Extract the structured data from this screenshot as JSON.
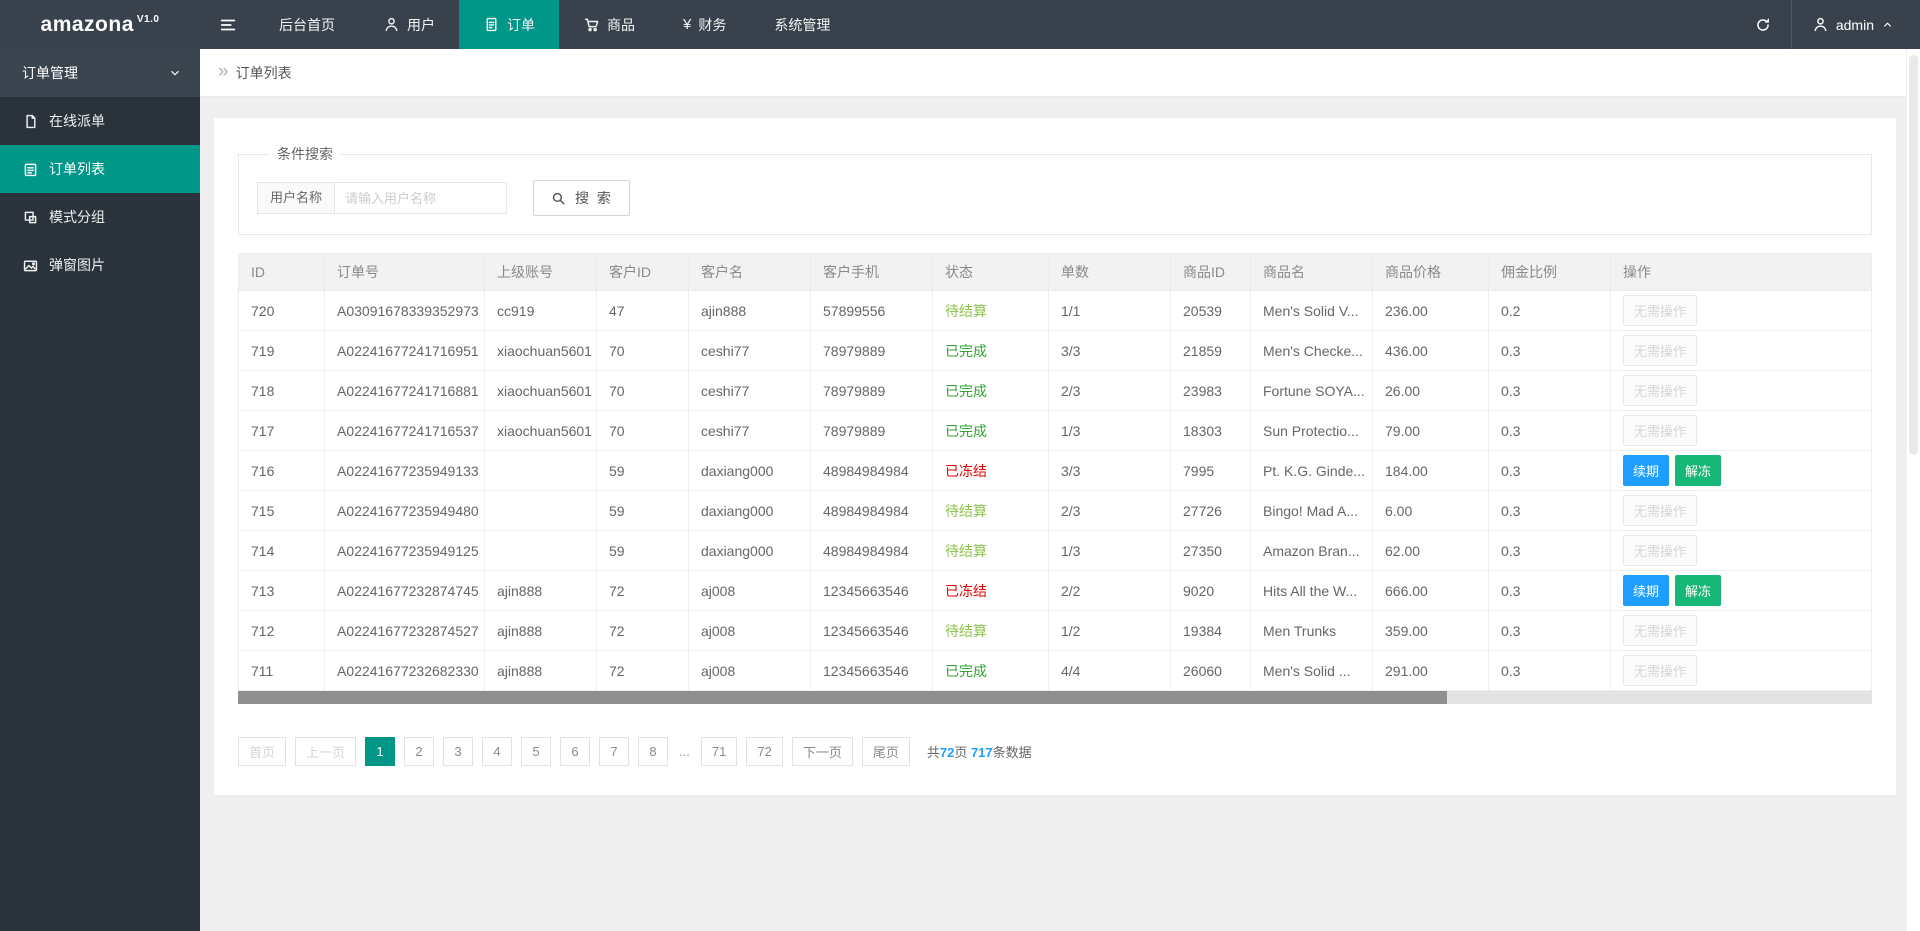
{
  "colors": {
    "navbar": "#39424c",
    "sidebar": "#2a333c",
    "accent": "#009688",
    "blue": "#1e9fff",
    "green2": "#16b777",
    "status-pending": "#8bc34a",
    "status-done": "#2da52d",
    "status-frozen": "#e60000"
  },
  "brand": {
    "name": "amazona",
    "version": "V1.0"
  },
  "navbar": {
    "items": [
      {
        "key": "home",
        "label": "后台首页",
        "icon": null,
        "active": false
      },
      {
        "key": "users",
        "label": "用户",
        "icon": "user",
        "active": false
      },
      {
        "key": "orders",
        "label": "订单",
        "icon": "file",
        "active": true
      },
      {
        "key": "goods",
        "label": "商品",
        "icon": "cart",
        "active": false
      },
      {
        "key": "finance",
        "label": "财务",
        "icon": "yen",
        "active": false
      },
      {
        "key": "system",
        "label": "系统管理",
        "icon": null,
        "active": false
      }
    ],
    "user": {
      "name": "admin"
    }
  },
  "sidebar": {
    "group_label": "订单管理",
    "items": [
      {
        "key": "online-dispatch",
        "label": "在线派单",
        "icon": "doc",
        "active": false
      },
      {
        "key": "order-list",
        "label": "订单列表",
        "icon": "list",
        "active": true
      },
      {
        "key": "mode-group",
        "label": "模式分组",
        "icon": "group",
        "active": false
      },
      {
        "key": "popup-image",
        "label": "弹窗图片",
        "icon": "image",
        "active": false
      }
    ]
  },
  "breadcrumb": {
    "title": "订单列表"
  },
  "search": {
    "legend": "条件搜索",
    "field_label": "用户名称",
    "placeholder": "请输入用户名称",
    "button_label": "搜 索"
  },
  "table": {
    "headers": [
      "ID",
      "订单号",
      "上级账号",
      "客户ID",
      "客户名",
      "客户手机",
      "状态",
      "单数",
      "商品ID",
      "商品名",
      "商品价格",
      "佣金比例",
      "操作"
    ],
    "action_labels": {
      "none": "无需操作",
      "renew": "续期",
      "unfreeze": "解冻"
    },
    "rows": [
      {
        "id": "720",
        "order_no": "A03091678339352973",
        "parent": "cc919",
        "customer_id": "47",
        "customer_name": "ajin888",
        "phone": "57899556",
        "status": "待结算",
        "status_type": "pending",
        "count": "1/1",
        "product_id": "20539",
        "product_name": "Men's Solid V...",
        "price": "236.00",
        "ratio": "0.2",
        "actions": "none"
      },
      {
        "id": "719",
        "order_no": "A02241677241716951",
        "parent": "xiaochuan5601",
        "customer_id": "70",
        "customer_name": "ceshi77",
        "phone": "78979889",
        "status": "已完成",
        "status_type": "done",
        "count": "3/3",
        "product_id": "21859",
        "product_name": "Men's Checke...",
        "price": "436.00",
        "ratio": "0.3",
        "actions": "none"
      },
      {
        "id": "718",
        "order_no": "A02241677241716881",
        "parent": "xiaochuan5601",
        "customer_id": "70",
        "customer_name": "ceshi77",
        "phone": "78979889",
        "status": "已完成",
        "status_type": "done",
        "count": "2/3",
        "product_id": "23983",
        "product_name": "Fortune SOYA...",
        "price": "26.00",
        "ratio": "0.3",
        "actions": "none"
      },
      {
        "id": "717",
        "order_no": "A02241677241716537",
        "parent": "xiaochuan5601",
        "customer_id": "70",
        "customer_name": "ceshi77",
        "phone": "78979889",
        "status": "已完成",
        "status_type": "done",
        "count": "1/3",
        "product_id": "18303",
        "product_name": "Sun Protectio...",
        "price": "79.00",
        "ratio": "0.3",
        "actions": "none"
      },
      {
        "id": "716",
        "order_no": "A02241677235949133",
        "parent": "",
        "customer_id": "59",
        "customer_name": "daxiang000",
        "phone": "48984984984",
        "status": "已冻结",
        "status_type": "frozen",
        "count": "3/3",
        "product_id": "7995",
        "product_name": "Pt. K.G. Ginde...",
        "price": "184.00",
        "ratio": "0.3",
        "actions": "frozen"
      },
      {
        "id": "715",
        "order_no": "A02241677235949480",
        "parent": "",
        "customer_id": "59",
        "customer_name": "daxiang000",
        "phone": "48984984984",
        "status": "待结算",
        "status_type": "pending",
        "count": "2/3",
        "product_id": "27726",
        "product_name": "Bingo! Mad A...",
        "price": "6.00",
        "ratio": "0.3",
        "actions": "none"
      },
      {
        "id": "714",
        "order_no": "A02241677235949125",
        "parent": "",
        "customer_id": "59",
        "customer_name": "daxiang000",
        "phone": "48984984984",
        "status": "待结算",
        "status_type": "pending",
        "count": "1/3",
        "product_id": "27350",
        "product_name": "Amazon Bran...",
        "price": "62.00",
        "ratio": "0.3",
        "actions": "none"
      },
      {
        "id": "713",
        "order_no": "A02241677232874745",
        "parent": "ajin888",
        "customer_id": "72",
        "customer_name": "aj008",
        "phone": "12345663546",
        "status": "已冻结",
        "status_type": "frozen",
        "count": "2/2",
        "product_id": "9020",
        "product_name": "Hits All the W...",
        "price": "666.00",
        "ratio": "0.3",
        "actions": "frozen"
      },
      {
        "id": "712",
        "order_no": "A02241677232874527",
        "parent": "ajin888",
        "customer_id": "72",
        "customer_name": "aj008",
        "phone": "12345663546",
        "status": "待结算",
        "status_type": "pending",
        "count": "1/2",
        "product_id": "19384",
        "product_name": "Men Trunks",
        "price": "359.00",
        "ratio": "0.3",
        "actions": "none"
      },
      {
        "id": "711",
        "order_no": "A02241677232682330",
        "parent": "ajin888",
        "customer_id": "72",
        "customer_name": "aj008",
        "phone": "12345663546",
        "status": "已完成",
        "status_type": "done",
        "count": "4/4",
        "product_id": "26060",
        "product_name": "Men's Solid ...",
        "price": "291.00",
        "ratio": "0.3",
        "actions": "none"
      }
    ]
  },
  "pagination": {
    "items": [
      {
        "label": "首页",
        "state": "disabled"
      },
      {
        "label": "上一页",
        "state": "disabled"
      },
      {
        "label": "1",
        "state": "active"
      },
      {
        "label": "2",
        "state": "normal"
      },
      {
        "label": "3",
        "state": "normal"
      },
      {
        "label": "4",
        "state": "normal"
      },
      {
        "label": "5",
        "state": "normal"
      },
      {
        "label": "6",
        "state": "normal"
      },
      {
        "label": "7",
        "state": "normal"
      },
      {
        "label": "8",
        "state": "normal"
      },
      {
        "label": "...",
        "state": "gap"
      },
      {
        "label": "71",
        "state": "normal"
      },
      {
        "label": "72",
        "state": "normal"
      },
      {
        "label": "下一页",
        "state": "normal"
      },
      {
        "label": "尾页",
        "state": "normal"
      }
    ],
    "summary": {
      "prefix": "共",
      "pages": "72",
      "middle": "页 ",
      "count": "717",
      "suffix": "条数据"
    }
  }
}
